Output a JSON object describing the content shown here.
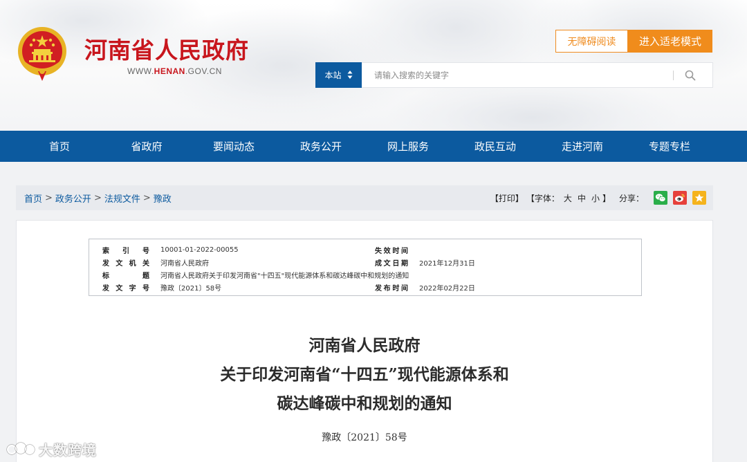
{
  "header": {
    "site_name": "河南省人民政府",
    "url_prefix": "WWW.",
    "url_highlight": "HENAN",
    "url_suffix": ".GOV.CN",
    "accessibility_label": "无障碍阅读",
    "elder_mode_label": "进入适老模式",
    "search": {
      "scope_label": "本站",
      "placeholder": "请输入搜索的关键字"
    }
  },
  "nav": {
    "items": [
      "首页",
      "省政府",
      "要闻动态",
      "政务公开",
      "网上服务",
      "政民互动",
      "走进河南",
      "专题专栏"
    ]
  },
  "breadcrumb": {
    "items": [
      "首页",
      "政务公开",
      "法规文件",
      "豫政"
    ],
    "separator": ">"
  },
  "tools": {
    "print_label": "【打印】",
    "font_open": "【字体：",
    "font_large": "大",
    "font_medium": "中",
    "font_small": "小",
    "font_close": "】",
    "share_label": "分享："
  },
  "meta": {
    "index_no_label": "索 引 号",
    "index_no": "10001-01-2022-00055",
    "expiry_label": "失效时间",
    "expiry": "",
    "issuer_label": "发文机关",
    "issuer": "河南省人民政府",
    "written_date_label": "成文日期",
    "written_date": "2021年12月31日",
    "title_label": "标 题",
    "title": "河南省人民政府关于印发河南省\"十四五\"现代能源体系和碳达峰碳中和规划的通知",
    "doc_no_label": "发文字号",
    "doc_no": "豫政〔2021〕58号",
    "publish_label": "发布时间",
    "publish_date": "2022年02月22日"
  },
  "document": {
    "title_lines": [
      "河南省人民政府",
      "关于印发河南省“十四五”现代能源体系和",
      "碳达峰碳中和规划的通知"
    ],
    "doc_no": "豫政〔2021〕58号"
  },
  "watermark": {
    "text": "大数跨境"
  },
  "colors": {
    "brand_red": "#c8161d",
    "nav_blue": "#0c5a9f",
    "accent_orange": "#f08c1c",
    "wechat_green": "#2aae4a",
    "weibo_red": "#e6403b",
    "favorite_yellow": "#f5b31c"
  },
  "icons": [
    "national-emblem-icon",
    "sort-arrows-icon",
    "search-icon",
    "wechat-icon",
    "weibo-icon",
    "star-icon"
  ]
}
